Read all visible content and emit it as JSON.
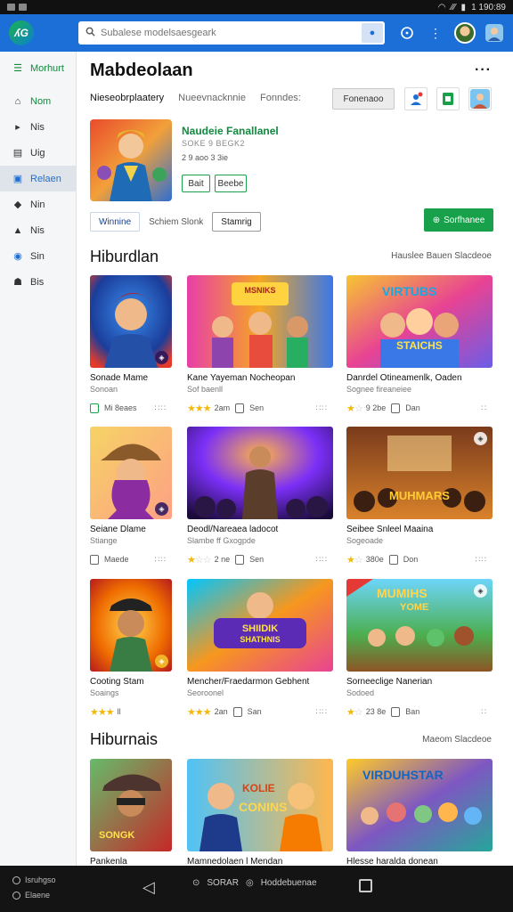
{
  "status_bar": {
    "time": "1 190:89"
  },
  "topbar": {
    "logo_text": "ʎG",
    "search_placeholder": "Subalese modelsaesgeark"
  },
  "rail": {
    "menu_label": "Morhurt",
    "items": [
      {
        "label": "Nom",
        "icon": "home-icon",
        "glyph": "⌂"
      },
      {
        "label": "Nis",
        "icon": "play-icon",
        "glyph": "▸"
      },
      {
        "label": "Uig",
        "icon": "apps-icon",
        "glyph": "▤"
      },
      {
        "label": "Relaen",
        "icon": "library-icon",
        "glyph": "▣"
      },
      {
        "label": "Nin",
        "icon": "bag-icon",
        "glyph": "◆"
      },
      {
        "label": "Nis",
        "icon": "tag-icon",
        "glyph": "▲"
      },
      {
        "label": "Sin",
        "icon": "globe-icon",
        "glyph": "◉"
      },
      {
        "label": "Bis",
        "icon": "group-icon",
        "glyph": "☗"
      }
    ]
  },
  "header": {
    "title": "Mabdeolaan",
    "filter_1": "Nieseobrplaatery",
    "filter_2": "Nueevnacknnie",
    "filter_3": "Fonndes:",
    "action_button": "Fonenaoo"
  },
  "featured": {
    "title": "Naudeie Fanallanel",
    "meta_1": "SOKE 9 BEGK2",
    "meta_2": "2 9 aoo 3 3ie",
    "chip_1": "Bait",
    "chip_2": "Beebe"
  },
  "tabs": {
    "tab_1": "Winnine",
    "tab_2": "Schiem Slonk",
    "tab_3": "Stamrig",
    "green_button": "Sorfhanee"
  },
  "section_1": {
    "title": "Hiburdlan",
    "links": "Hauslee Bauen Slacdeoe"
  },
  "section_2": {
    "title": "Hiburnais",
    "links": "Maeom Slacdeoe"
  },
  "cards": [
    {
      "name": "Sonade Mame",
      "sub": "Sonoan",
      "rating_text": "Mi 8eaes",
      "stars": 0
    },
    {
      "name": "Kane Yayeman Nocheopan",
      "sub": "Sof baenll",
      "rating_text": "2am",
      "stars": 3,
      "dl_text": "Sen"
    },
    {
      "name": "Danrdel Otineamenlk, Oaden",
      "sub": "Sognee fireaneiee",
      "rating_text": "9 2be",
      "stars": 1,
      "dl_text": "Dan"
    },
    {
      "name": "Seiane Dlame",
      "sub": "Stiange",
      "rating_text": "Maede",
      "stars": 0
    },
    {
      "name": "Deodl/Nareaea ladocot",
      "sub": "Slambe ff Gxogpde",
      "rating_text": "2 ne",
      "stars": 1,
      "dl_text": "Sen"
    },
    {
      "name": "Seibee Snleel Maaina",
      "sub": "Sogeoade",
      "rating_text": "380e",
      "stars": 1,
      "dl_text": "Don"
    },
    {
      "name": "Cooting Stam",
      "sub": "Soaings",
      "rating_text": "ll",
      "stars": 3
    },
    {
      "name": "Mencher/Fraedarmon Gebhent",
      "sub": "Seoroonel",
      "rating_text": "2an",
      "stars": 3,
      "dl_text": "San"
    },
    {
      "name": "Sorneeclige Nanerian",
      "sub": "Sodoed",
      "rating_text": "23 8e",
      "stars": 1,
      "dl_text": "Ban"
    },
    {
      "name": "Pankenla",
      "sub": "",
      "rating_text": ""
    },
    {
      "name": "Mamnedolaen l Mendan",
      "sub": "",
      "rating_text": ""
    },
    {
      "name": "Hlesse haralda donean",
      "sub": "",
      "rating_text": ""
    }
  ],
  "art_text": {
    "a3": "VIRTUBS",
    "a3b": "STAICHS",
    "a2": "MSNIKS",
    "a6": "MUHMARS",
    "a8": "SHIIDIK",
    "a8b": "SHATHNIS",
    "a9": "MUMIHS",
    "a9b": "YOME",
    "a10": "SONGK",
    "a11": "KOLIE",
    "a11b": "CONINS",
    "a12": "VIRDUHSTAR"
  },
  "navbar": {
    "left_1": "Isruhgso",
    "left_2": "Elaene",
    "center_1": "SORAR",
    "center_2": "Hoddebuenae"
  },
  "colors": {
    "brand_blue": "#1b6fd6",
    "accent_green": "#19a04a",
    "star": "#f2b90c"
  }
}
